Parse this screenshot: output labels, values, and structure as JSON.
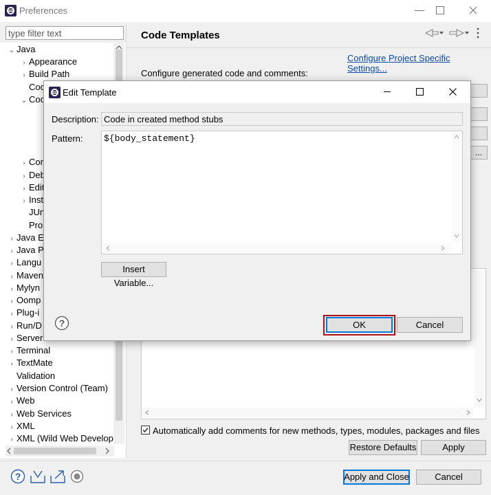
{
  "window": {
    "title": "Preferences",
    "filter_placeholder": "type filter text"
  },
  "tree": {
    "items": [
      {
        "label": "Java",
        "chev": "⌄"
      },
      {
        "label": "Appearance",
        "chev": "›"
      },
      {
        "label": "Build Path",
        "chev": "›"
      },
      {
        "label": "Coc",
        "chev": ""
      },
      {
        "label": "Coc",
        "chev": "⌄"
      },
      {
        "label": "Cor",
        "chev": "›"
      },
      {
        "label": "Deb",
        "chev": "›"
      },
      {
        "label": "Edit",
        "chev": "›"
      },
      {
        "label": "Inst",
        "chev": "›"
      },
      {
        "label": "JUn",
        "chev": ""
      },
      {
        "label": "Pro",
        "chev": ""
      },
      {
        "label": "Java E",
        "chev": "›"
      },
      {
        "label": "Java P",
        "chev": "›"
      },
      {
        "label": "Langu",
        "chev": "›"
      },
      {
        "label": "Maven",
        "chev": "›"
      },
      {
        "label": "Mylyn",
        "chev": "›"
      },
      {
        "label": "Oomp",
        "chev": "›"
      },
      {
        "label": "Plug-i",
        "chev": "›"
      },
      {
        "label": "Run/D",
        "chev": "›"
      },
      {
        "label": "Server",
        "chev": "›"
      },
      {
        "label": "Terminal",
        "chev": "›"
      },
      {
        "label": "TextMate",
        "chev": "›"
      },
      {
        "label": "Validation",
        "chev": ""
      },
      {
        "label": "Version Control (Team)",
        "chev": "›"
      },
      {
        "label": "Web",
        "chev": "›"
      },
      {
        "label": "Web Services",
        "chev": "›"
      },
      {
        "label": "XML",
        "chev": "›"
      },
      {
        "label": "XML (Wild Web Develop",
        "chev": "›"
      }
    ]
  },
  "panel": {
    "title": "Code Templates",
    "configure_link": "Configure Project Specific Settings...",
    "description": "Configure generated code and comments:",
    "auto_comments_label": "Automatically add comments for new methods, types, modules, packages and files",
    "auto_comments_checked": true,
    "restore_defaults": "Restore Defaults",
    "apply": "Apply",
    "side_button_partial": "..."
  },
  "footer": {
    "apply_and_close": "Apply and Close",
    "cancel": "Cancel"
  },
  "dialog": {
    "title": "Edit Template",
    "description_label": "Description:",
    "description_value": "Code in created method stubs",
    "pattern_label": "Pattern:",
    "pattern_value": "${body_statement}",
    "insert_variable": "Insert Variable...",
    "ok": "OK",
    "cancel": "Cancel"
  },
  "colors": {
    "link": "#0a4aa8",
    "ok_highlight": "#b01010",
    "default_button_border": "#0078d7"
  }
}
